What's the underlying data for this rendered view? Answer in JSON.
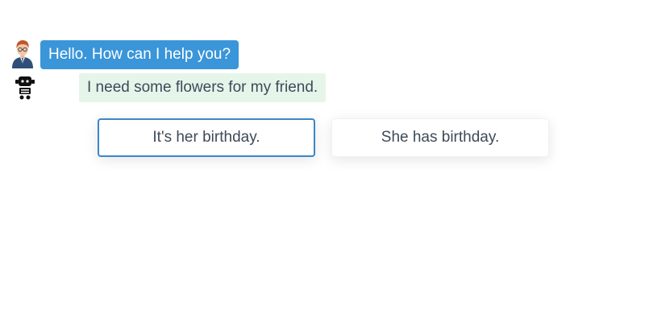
{
  "chat": {
    "messages": [
      {
        "sender": "agent",
        "icon": "agent-avatar-icon",
        "text": "Hello. How can I help you?"
      },
      {
        "sender": "user",
        "icon": "robot-avatar-icon",
        "text": "I need some flowers for my friend."
      }
    ],
    "choices": [
      {
        "label": "It's her birthday.",
        "selected": true
      },
      {
        "label": "She has birthday.",
        "selected": false
      }
    ]
  },
  "colors": {
    "agent_bubble": "#3a95d9",
    "user_bubble": "#e6f5ea",
    "choice_border_selected": "#3a87c9",
    "text": "#3e4a58"
  }
}
